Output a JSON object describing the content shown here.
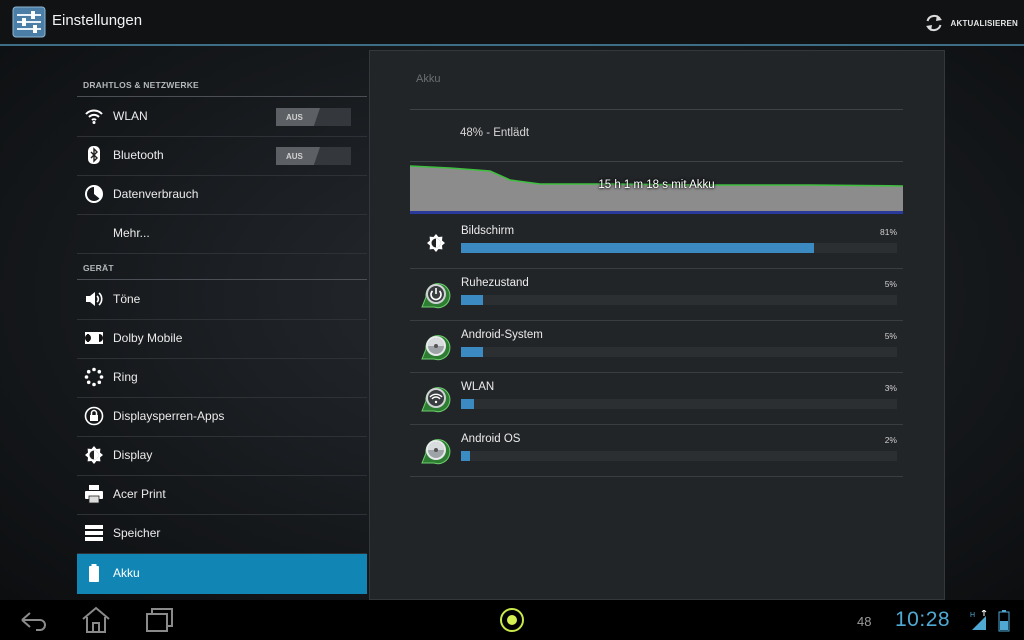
{
  "actionbar": {
    "title": "Einstellungen",
    "app_icon": "settings-sliders-icon",
    "refresh_icon": "refresh-icon",
    "refresh_label": "AKTUALISIEREN"
  },
  "sidebar": {
    "sections": [
      {
        "header": "DRAHTLOS & NETZWERKE"
      },
      {
        "header": "GERÄT"
      }
    ],
    "items": [
      {
        "label": "WLAN",
        "icon": "wifi-icon",
        "toggle": "AUS"
      },
      {
        "label": "Bluetooth",
        "icon": "bluetooth-icon",
        "toggle": "AUS"
      },
      {
        "label": "Datenverbrauch",
        "icon": "data-usage-icon"
      },
      {
        "label": "Mehr...",
        "icon": ""
      },
      {
        "label": "Töne",
        "icon": "speaker-icon"
      },
      {
        "label": "Dolby Mobile",
        "icon": "dolby-icon"
      },
      {
        "label": "Ring",
        "icon": "ring-icon"
      },
      {
        "label": "Displaysperren-Apps",
        "icon": "lock-apps-icon"
      },
      {
        "label": "Display",
        "icon": "brightness-icon"
      },
      {
        "label": "Acer Print",
        "icon": "printer-icon"
      },
      {
        "label": "Speicher",
        "icon": "storage-icon"
      },
      {
        "label": "Akku",
        "icon": "battery-icon",
        "selected": true
      }
    ]
  },
  "detail": {
    "title": "Akku",
    "status": "48% - Entlädt",
    "graph_label": "15 h 1 m 18 s mit Akku",
    "graph_colors": {
      "line": "#3fbf3f",
      "fill": "#8c8c8c",
      "bottom": "#2a3a9a"
    },
    "usage": [
      {
        "name": "Bildschirm",
        "percent_label": "81%",
        "percent": 81,
        "icon": "brightness-icon"
      },
      {
        "name": "Ruhezustand",
        "percent_label": "5%",
        "percent": 5,
        "icon": "power-icon"
      },
      {
        "name": "Android-System",
        "percent_label": "5%",
        "percent": 5,
        "icon": "android-system-icon"
      },
      {
        "name": "WLAN",
        "percent_label": "3%",
        "percent": 3,
        "icon": "wifi-icon"
      },
      {
        "name": "Android OS",
        "percent_label": "2%",
        "percent": 2,
        "icon": "android-os-icon"
      }
    ]
  },
  "navbar": {
    "back_icon": "back-icon",
    "home_icon": "home-icon",
    "recents_icon": "recents-icon",
    "center_icon": "ring-launcher-icon",
    "notification_count": "48",
    "time": "10:28",
    "signal_icon": "hsdpa-signal-icon",
    "battery_icon": "battery-icon"
  },
  "colors": {
    "accent": "#1186b4",
    "bar": "#3b8bc2",
    "time": "#4fa9d3"
  }
}
